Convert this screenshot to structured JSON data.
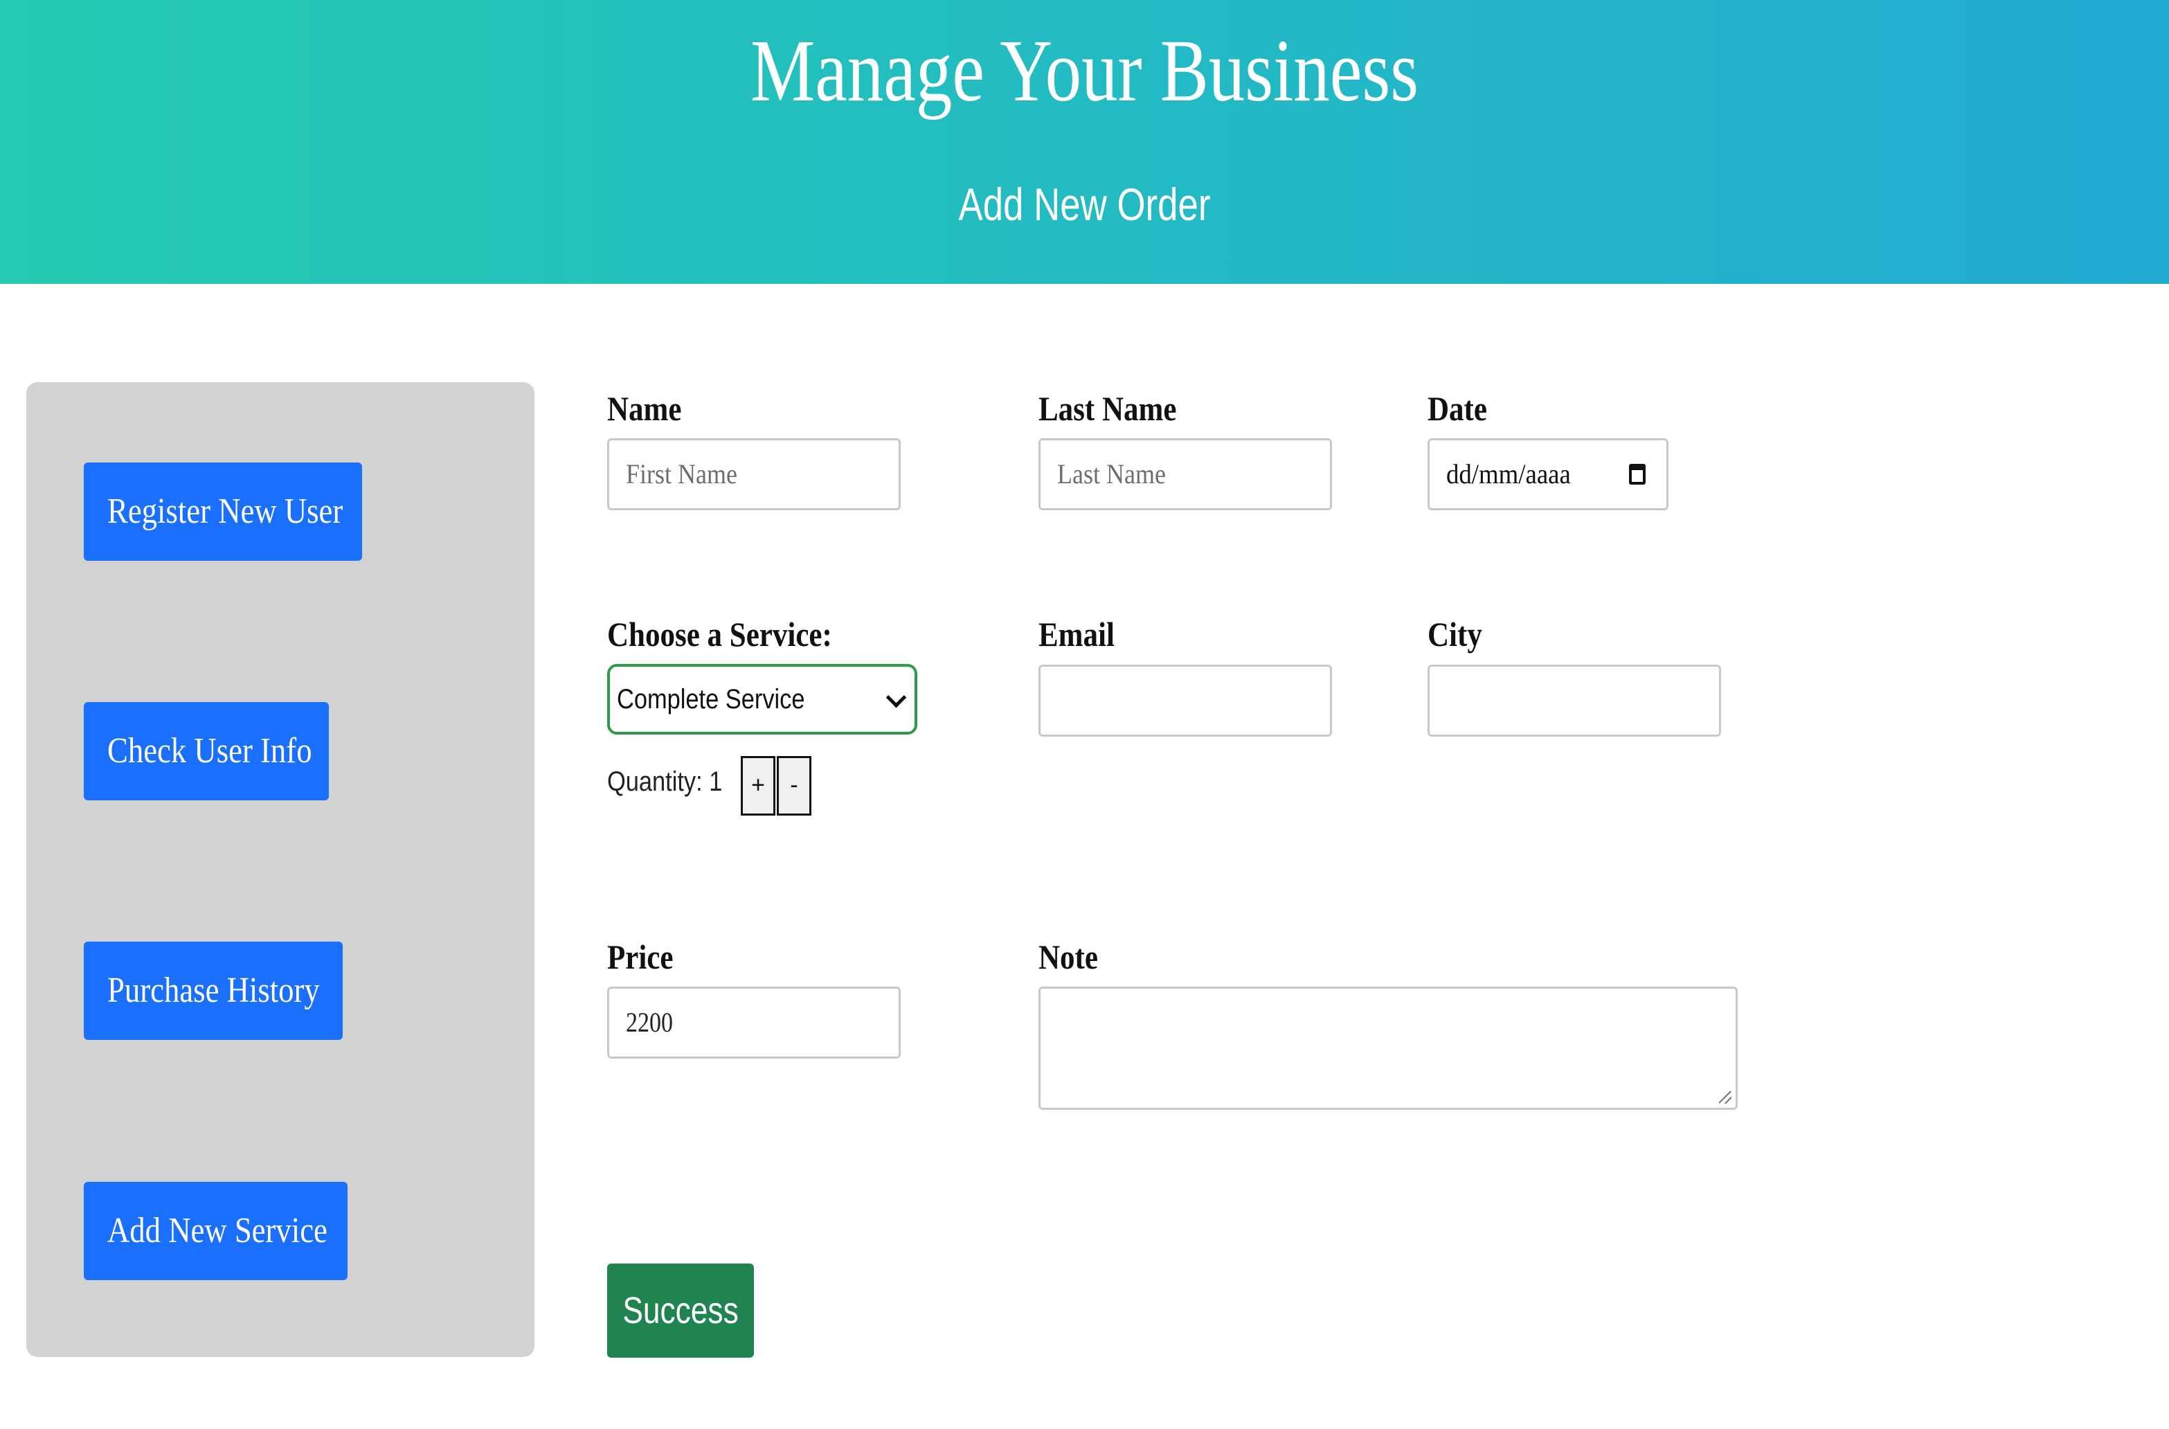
{
  "header": {
    "title": "Manage Your Business",
    "subtitle": "Add New Order"
  },
  "sidebar": {
    "items": [
      {
        "label": "Register New User"
      },
      {
        "label": "Check User Info"
      },
      {
        "label": "Purchase History"
      },
      {
        "label": "Add New Service"
      }
    ]
  },
  "form": {
    "name": {
      "label": "Name",
      "placeholder": "First Name",
      "value": ""
    },
    "last_name": {
      "label": "Last Name",
      "placeholder": "Last Name",
      "value": ""
    },
    "date": {
      "label": "Date",
      "placeholder": "dd/mm/aaaa",
      "icon": "calendar-icon"
    },
    "service": {
      "label": "Choose a Service:",
      "selected": "Complete Service",
      "accent": "#2e9a4a"
    },
    "quantity": {
      "label": "Quantity: 1",
      "plus": "+",
      "minus": "-"
    },
    "email": {
      "label": "Email",
      "value": ""
    },
    "city": {
      "label": "City",
      "value": ""
    },
    "price": {
      "label": "Price",
      "value": "2200"
    },
    "note": {
      "label": "Note",
      "value": ""
    },
    "submit": {
      "label": "Success",
      "color": "#1f8450"
    }
  },
  "colors": {
    "header_gradient_start": "#26cbb2",
    "header_gradient_end": "#22aad2",
    "sidebar_bg": "#d3d3d3",
    "nav_button": "#1a6ffc"
  }
}
